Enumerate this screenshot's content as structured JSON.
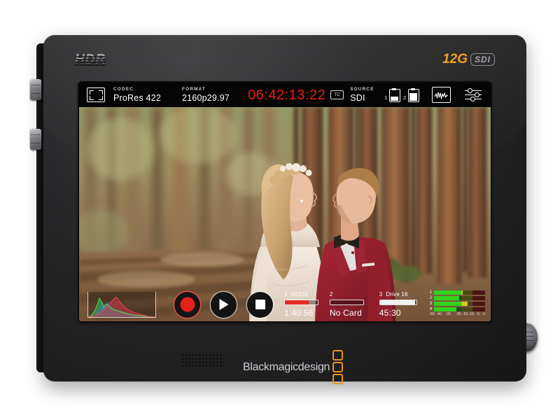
{
  "device": {
    "brand_text": "Blackmagicdesign",
    "hdr_badge": "HDR",
    "sdi_badge_12g": "12G",
    "sdi_badge_sdi": "SDI",
    "accent_orange": "#e8911a",
    "record_red": "#e4201a"
  },
  "topbar": {
    "frame_icon": "frame-corners-icon",
    "codec": {
      "label": "CODEC",
      "value": "ProRes 422"
    },
    "format": {
      "label": "FORMAT",
      "value": "2160p29.97"
    },
    "timecode": "06:42:13:22",
    "timecode_color": "#ef1d12",
    "timecode_badge": "TC",
    "source": {
      "label": "SOURCE",
      "value": "SDI"
    },
    "batteries": [
      {
        "number": "1",
        "level_pct": 48
      },
      {
        "number": "2",
        "level_pct": 82
      }
    ],
    "scope_icon": "waveform-scope-icon",
    "settings_icon": "sliders-icon"
  },
  "transport": {
    "record_label": "Record",
    "play_label": "Play",
    "stop_label": "Stop"
  },
  "histogram": {
    "label": "RGB Histogram",
    "channels": [
      "red",
      "green",
      "blue"
    ]
  },
  "media": {
    "slots": [
      {
        "number": "1",
        "name": "VA101",
        "remaining": "1:40:56",
        "used_pct": 72,
        "bar_color": "#e42a22",
        "status": "recording"
      },
      {
        "number": "2",
        "name": "",
        "remaining": "No Card",
        "used_pct": 0,
        "bar_color": "#8b8b8b",
        "status": "empty"
      },
      {
        "number": "3",
        "name": "Drive 16",
        "remaining": "45:30",
        "used_pct": 96,
        "bar_color": "#f0f0f0",
        "status": "ready"
      }
    ]
  },
  "audio": {
    "channels": [
      {
        "number": "1",
        "level_pct": 56
      },
      {
        "number": "2",
        "level_pct": 50
      },
      {
        "number": "3",
        "level_pct": 66
      },
      {
        "number": "4",
        "level_pct": 44
      }
    ],
    "scale": [
      "-50",
      "-40",
      "-30",
      "-20",
      "-15",
      "-10",
      "-5",
      "0"
    ],
    "zone_green_end_pct": 54,
    "zone_yellow_end_pct": 76,
    "colors": {
      "green": "#2fd21f",
      "yellow": "#d6c81e",
      "red": "#cf2222"
    }
  }
}
